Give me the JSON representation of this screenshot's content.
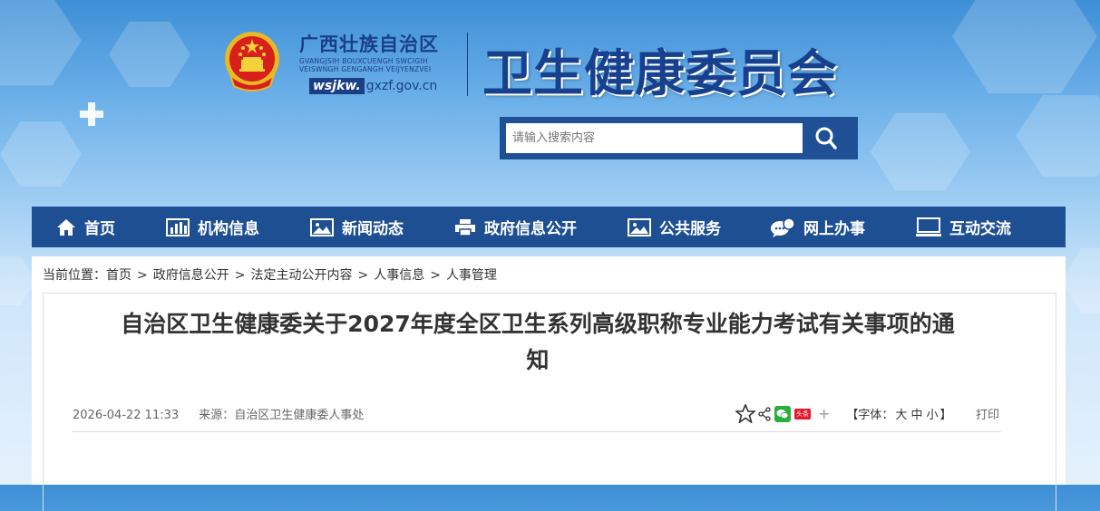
{
  "header": {
    "region_name": "广西壮族自治区",
    "region_sub_line1": "GVANGJSIH BOUXCUENGH SWCIGIH",
    "region_sub_line2": "VEISWNGH GENGANGH VEIJYENZVEI",
    "domain_prefix": "wsjkw.",
    "domain_suffix": "gxzf.gov.cn",
    "site_title": "卫生健康委员会",
    "emblem_icon": "national-emblem-icon"
  },
  "search": {
    "placeholder": "请输入搜索内容",
    "button_icon": "search-icon"
  },
  "nav": {
    "items": [
      {
        "label": "首页",
        "icon": "home-icon"
      },
      {
        "label": "机构信息",
        "icon": "bar-chart-icon"
      },
      {
        "label": "新闻动态",
        "icon": "image-icon"
      },
      {
        "label": "政府信息公开",
        "icon": "printer-icon"
      },
      {
        "label": "公共服务",
        "icon": "image-icon"
      },
      {
        "label": "网上办事",
        "icon": "chat-bubble-icon"
      },
      {
        "label": "互动交流",
        "icon": "monitor-icon"
      }
    ]
  },
  "breadcrumb": {
    "prefix": "当前位置：",
    "items": [
      "首页",
      "政府信息公开",
      "法定主动公开内容",
      "人事信息",
      "人事管理"
    ],
    "separator": ">"
  },
  "article": {
    "title_line1": "自治区卫生健康委关于2027年度全区卫生系列高级职称专业能力考试有关事项的通",
    "title_line2": "知",
    "date": "2026-04-22 11:33",
    "source_label": "来源：",
    "source": "自治区卫生健康委人事处",
    "font_label_open": "【字体：",
    "font_large": "大",
    "font_medium": "中",
    "font_small": "小",
    "font_label_close": "】",
    "print_label": "打印",
    "plus_sign": "+",
    "toutiao_badge": "头条"
  },
  "colors": {
    "nav_bg": "#1d4f92",
    "title_blue": "#17418f",
    "wechat_green": "#2aae3b",
    "weibo_red": "#e6162d"
  }
}
